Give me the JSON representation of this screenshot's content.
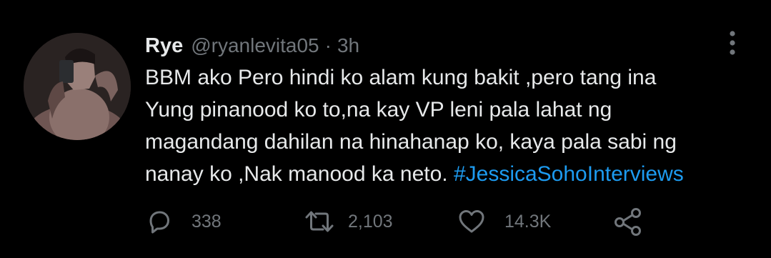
{
  "tweet": {
    "display_name": "Rye",
    "handle": "@ryanlevita05",
    "separator": "·",
    "time": "3h",
    "text_lines": [
      "BBM ako Pero hindi ko alam kung bakit ,pero tang ina",
      "Yung pinanood ko to,na kay VP leni pala lahat ng",
      "magandang dahilan na hinahanap ko, kaya pala sabi ng",
      "nanay ko ,Nak manood ka neto. "
    ],
    "hashtag": "#JessicaSohoInterviews"
  },
  "actions": {
    "reply_count": "338",
    "retweet_count": "2,103",
    "like_count": "14.3K"
  },
  "icons": {
    "more": "more-vertical-icon",
    "reply": "reply-icon",
    "retweet": "retweet-icon",
    "like": "heart-icon",
    "share": "share-icon"
  },
  "colors": {
    "background": "#000000",
    "text": "#e7e9ea",
    "secondary": "#71767b",
    "link": "#1d9bf0"
  }
}
